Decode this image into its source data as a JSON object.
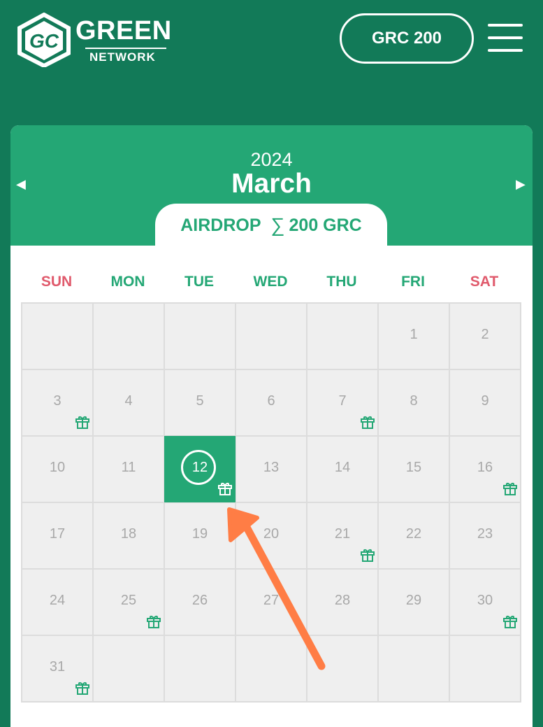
{
  "header": {
    "logo_text": "GREEN",
    "logo_subtext": "NETWORK",
    "logo_mark_icon": "gc-hexagon-logo-icon",
    "balance_label": "GRC 200",
    "menu_icon": "hamburger-menu-icon"
  },
  "calendar": {
    "year": "2024",
    "month": "March",
    "prev_icon": "◀",
    "next_icon": "▶",
    "airdrop_label": "AIRDROP",
    "airdrop_sigma": "∑",
    "airdrop_total": "200 GRC",
    "weekdays": [
      "SUN",
      "MON",
      "TUE",
      "WED",
      "THU",
      "FRI",
      "SAT"
    ],
    "selected_day": "12",
    "gift_icon": "gift-icon",
    "days": [
      {
        "label": "",
        "gift": false
      },
      {
        "label": "",
        "gift": false
      },
      {
        "label": "",
        "gift": false
      },
      {
        "label": "",
        "gift": false
      },
      {
        "label": "",
        "gift": false
      },
      {
        "label": "1",
        "gift": false
      },
      {
        "label": "2",
        "gift": false
      },
      {
        "label": "3",
        "gift": true
      },
      {
        "label": "4",
        "gift": false
      },
      {
        "label": "5",
        "gift": false
      },
      {
        "label": "6",
        "gift": false
      },
      {
        "label": "7",
        "gift": true
      },
      {
        "label": "8",
        "gift": false
      },
      {
        "label": "9",
        "gift": false
      },
      {
        "label": "10",
        "gift": false
      },
      {
        "label": "11",
        "gift": false
      },
      {
        "label": "12",
        "gift": true
      },
      {
        "label": "13",
        "gift": false
      },
      {
        "label": "14",
        "gift": false
      },
      {
        "label": "15",
        "gift": false
      },
      {
        "label": "16",
        "gift": true
      },
      {
        "label": "17",
        "gift": false
      },
      {
        "label": "18",
        "gift": false
      },
      {
        "label": "19",
        "gift": false
      },
      {
        "label": "20",
        "gift": false
      },
      {
        "label": "21",
        "gift": true
      },
      {
        "label": "22",
        "gift": false
      },
      {
        "label": "23",
        "gift": false
      },
      {
        "label": "24",
        "gift": false
      },
      {
        "label": "25",
        "gift": true
      },
      {
        "label": "26",
        "gift": false
      },
      {
        "label": "27",
        "gift": false
      },
      {
        "label": "28",
        "gift": false
      },
      {
        "label": "29",
        "gift": false
      },
      {
        "label": "30",
        "gift": true
      },
      {
        "label": "31",
        "gift": true
      },
      {
        "label": "",
        "gift": false
      },
      {
        "label": "",
        "gift": false
      },
      {
        "label": "",
        "gift": false
      },
      {
        "label": "",
        "gift": false
      },
      {
        "label": "",
        "gift": false
      },
      {
        "label": "",
        "gift": false
      }
    ]
  },
  "annotation": {
    "arrow_icon": "pointer-arrow-icon",
    "points_to_day": "12"
  },
  "colors": {
    "background": "#127a58",
    "accent": "#24a775",
    "weekend": "#e05a6c",
    "arrow": "#ff7d45",
    "cell": "#efefef",
    "day_number": "#a8a8a8"
  }
}
